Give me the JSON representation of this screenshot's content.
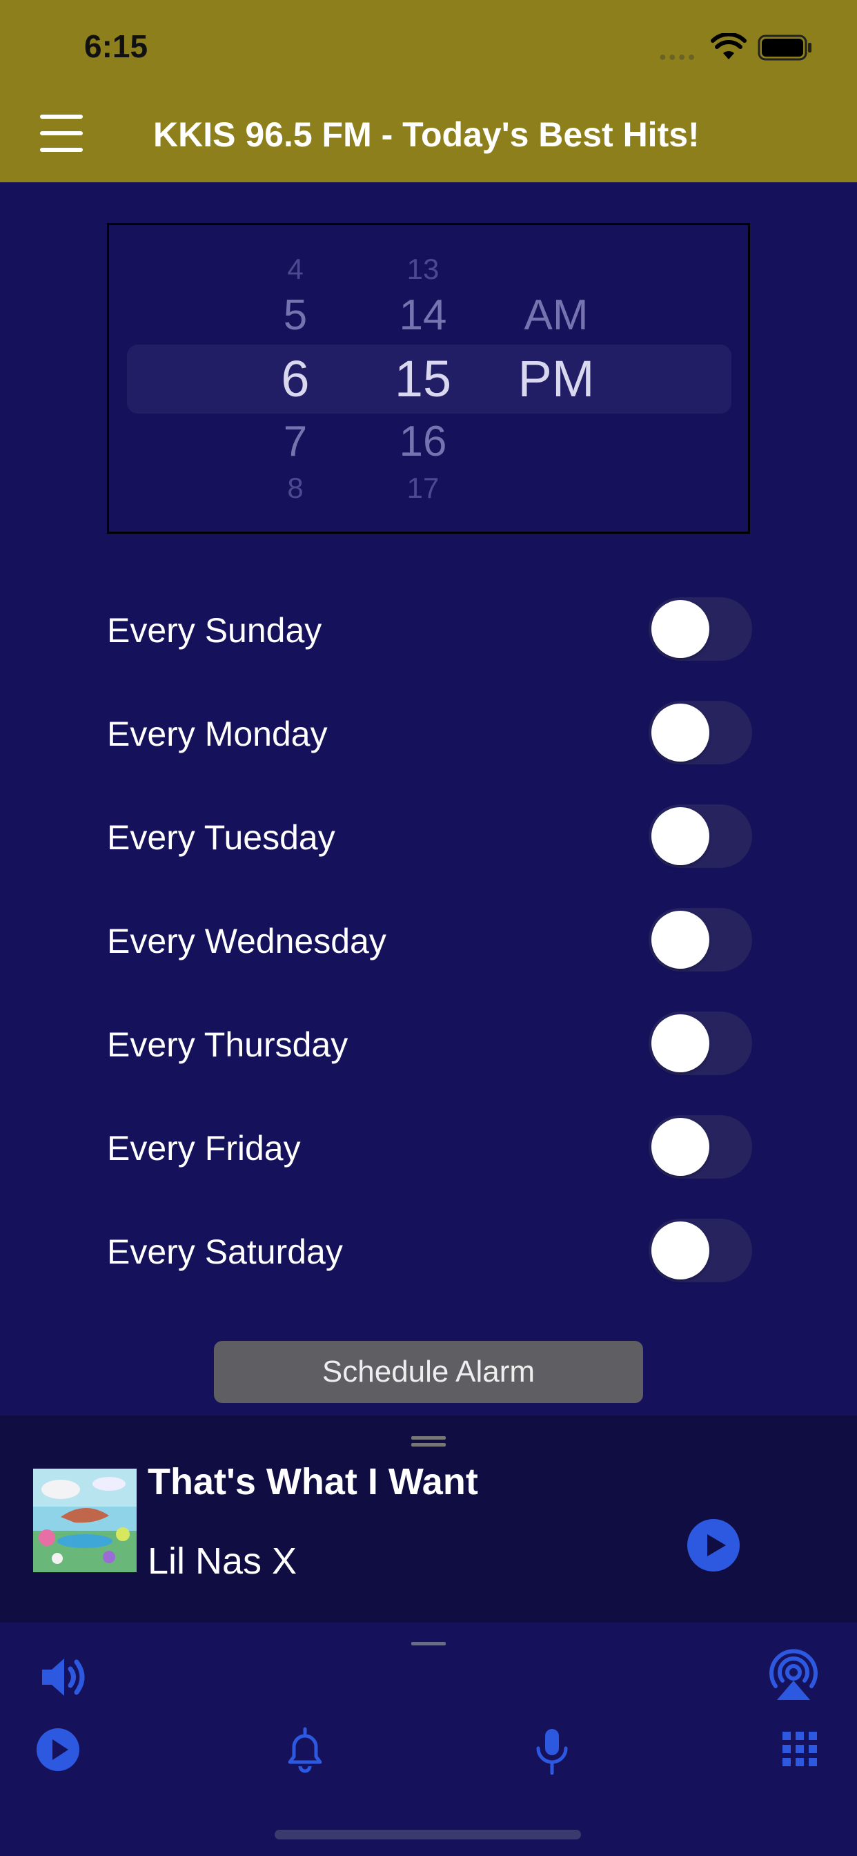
{
  "status": {
    "time": "6:15",
    "wifi_icon": "wifi-icon",
    "battery_icon": "battery-icon"
  },
  "header": {
    "title": "KKIS 96.5 FM - Today's Best Hits!",
    "menu_icon": "hamburger-menu-icon",
    "background": "#8c7f1c"
  },
  "picker": {
    "hours": [
      "4",
      "5",
      "6",
      "7",
      "8"
    ],
    "minutes": [
      "13",
      "14",
      "15",
      "16",
      "17"
    ],
    "periods": [
      "AM",
      "PM"
    ],
    "selected": {
      "hour": "6",
      "minute": "15",
      "period": "PM"
    }
  },
  "days": [
    {
      "label": "Every Sunday",
      "on": false
    },
    {
      "label": "Every Monday",
      "on": false
    },
    {
      "label": "Every Tuesday",
      "on": false
    },
    {
      "label": "Every Wednesday",
      "on": false
    },
    {
      "label": "Every Thursday",
      "on": false
    },
    {
      "label": "Every Friday",
      "on": false
    },
    {
      "label": "Every Saturday",
      "on": false
    }
  ],
  "schedule_button": "Schedule Alarm",
  "now_playing": {
    "song": "That's What I Want",
    "artist": "Lil Nas X",
    "play_icon": "play-circle-icon"
  },
  "bottom_bar": {
    "icons": [
      "volume-icon",
      "airplay-icon",
      "play-circle-icon",
      "bell-icon",
      "microphone-icon",
      "grid-icon"
    ],
    "accent": "#2d59e0"
  },
  "colors": {
    "background": "#15115a",
    "player_bg": "#100d42"
  }
}
